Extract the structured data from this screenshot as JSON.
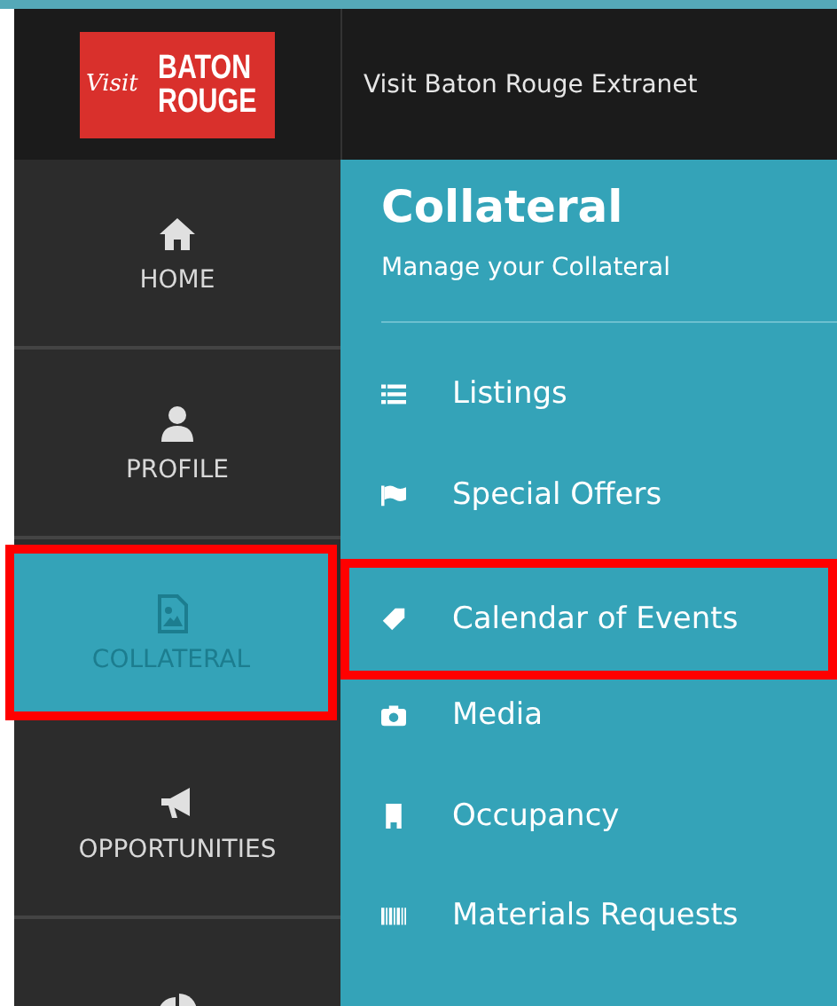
{
  "header": {
    "logo": {
      "script": "Visit",
      "line1": "BATON",
      "line2": "ROUGE"
    },
    "title": "Visit Baton Rouge Extranet"
  },
  "sidebar": {
    "items": [
      {
        "label": "HOME",
        "selected": false,
        "highlighted": false
      },
      {
        "label": "PROFILE",
        "selected": false,
        "highlighted": false
      },
      {
        "label": "COLLATERAL",
        "selected": true,
        "highlighted": true
      },
      {
        "label": "OPPORTUNITIES",
        "selected": false,
        "highlighted": false
      },
      {
        "selected": false,
        "highlighted": false
      }
    ]
  },
  "main": {
    "title": "Collateral",
    "subtitle": "Manage your Collateral",
    "menu": [
      {
        "label": "Listings",
        "highlighted": false
      },
      {
        "label": "Special Offers",
        "highlighted": false
      },
      {
        "label": "Calendar of Events",
        "highlighted": true
      },
      {
        "label": "Media",
        "highlighted": false
      },
      {
        "label": "Occupancy",
        "highlighted": false
      },
      {
        "label": "Materials Requests",
        "highlighted": false
      }
    ]
  }
}
